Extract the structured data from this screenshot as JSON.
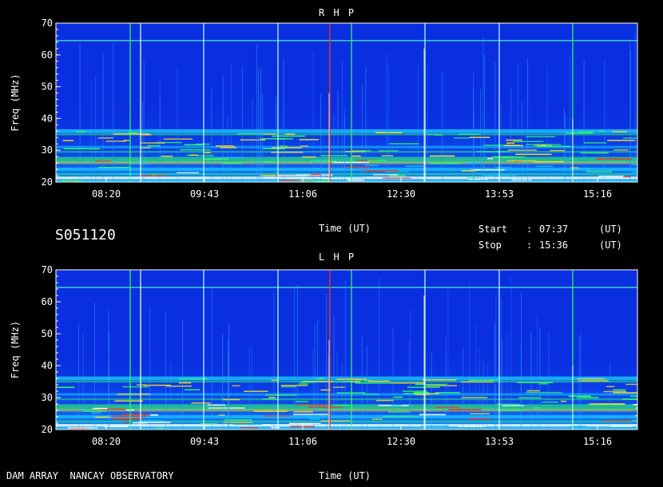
{
  "chart_data": [
    {
      "type": "heatmap",
      "title": "R H P",
      "ylabel": "Freq (MHz)",
      "xlabel": "Time (UT)",
      "y_ticks": [
        "20",
        "30",
        "40",
        "50",
        "60",
        "70"
      ],
      "x_ticks": [
        "08:20",
        "09:43",
        "11:06",
        "12:30",
        "13:53",
        "15:16"
      ],
      "ylim": [
        20,
        70
      ]
    },
    {
      "type": "heatmap",
      "title": "L H P",
      "ylabel": "Freq (MHz)",
      "xlabel": "Time (UT)",
      "y_ticks": [
        "20",
        "30",
        "40",
        "50",
        "60",
        "70"
      ],
      "x_ticks": [
        "08:20",
        "09:43",
        "11:06",
        "12:30",
        "13:53",
        "15:16"
      ],
      "ylim": [
        20,
        70
      ]
    }
  ],
  "info": {
    "code": "S051120",
    "start_label": "Start",
    "stop_label": "Stop",
    "colon": ":",
    "start_time": "07:37",
    "stop_time": "15:36",
    "unit": "(UT)"
  },
  "footer": {
    "source": "DAM ARRAY  NANCAY OBSERVATORY"
  },
  "colors": {
    "background": "#0a2fe0",
    "band": "#18c0ff",
    "strong": "#30ff60",
    "peak": "#ff3010",
    "white": "#ffffff"
  }
}
